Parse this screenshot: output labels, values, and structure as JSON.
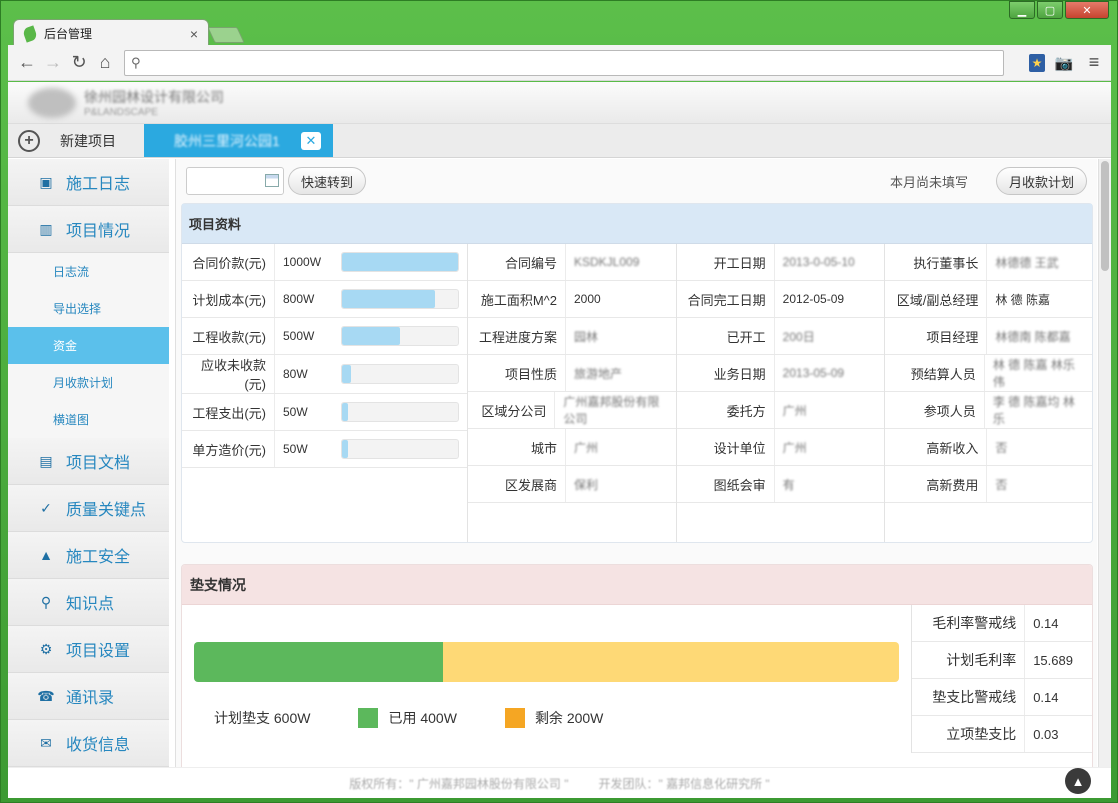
{
  "browser": {
    "tab_title": "后台管理",
    "tab_close": "×",
    "address": "",
    "controls": {
      "min": "▁",
      "max": "▢",
      "close": "✕"
    }
  },
  "header": {
    "company_cn": "徐州园林设计有限公司",
    "company_en": "P&LANDSCAPE"
  },
  "projectbar": {
    "new_project_label": "新建项目",
    "plus": "+",
    "open_tab": "胶州三里河公园1",
    "open_tab_close": "✕"
  },
  "sidebar": {
    "items": [
      {
        "label": "施工日志",
        "icon": "log-icon",
        "glyph": "▣"
      },
      {
        "label": "项目情况",
        "icon": "bar-chart-icon",
        "glyph": "▥"
      },
      {
        "label": "项目文档",
        "icon": "document-icon",
        "glyph": "▤"
      },
      {
        "label": "质量关键点",
        "icon": "quality-check-icon",
        "glyph": "✓"
      },
      {
        "label": "施工安全",
        "icon": "warning-icon",
        "glyph": "▲"
      },
      {
        "label": "知识点",
        "icon": "knowledge-search-icon",
        "glyph": "⚲"
      },
      {
        "label": "项目设置",
        "icon": "gear-icon",
        "glyph": "⚙"
      },
      {
        "label": "通讯录",
        "icon": "contacts-icon",
        "glyph": "☎"
      },
      {
        "label": "收货信息",
        "icon": "mail-icon",
        "glyph": "✉"
      }
    ],
    "subitems": [
      "日志流",
      "导出选择",
      "资金",
      "月收款计划",
      "横道图"
    ]
  },
  "toolbar": {
    "date_value": "",
    "goto_label": "快速转到",
    "month_status": "本月尚未填写",
    "monthly_plan_label": "月收款计划"
  },
  "project_info": {
    "title": "项目资料",
    "money": [
      {
        "label": "合同价款(元)",
        "value": "1000W",
        "fill": 1.0
      },
      {
        "label": "计划成本(元)",
        "value": "800W",
        "fill": 0.8
      },
      {
        "label": "工程收款(元)",
        "value": "500W",
        "fill": 0.5
      },
      {
        "label": "应收未收款(元)",
        "value": "80W",
        "fill": 0.08
      },
      {
        "label": "工程支出(元)",
        "value": "50W",
        "fill": 0.05
      },
      {
        "label": "单方造价(元)",
        "value": "50W",
        "fill": 0.05
      }
    ],
    "col2": [
      {
        "label": "合同编号",
        "value": "KSDKJL009"
      },
      {
        "label": "施工面积M^2",
        "value": "2000"
      },
      {
        "label": "工程进度方案",
        "value": "园林"
      },
      {
        "label": "项目性质",
        "value": "旅游地产"
      },
      {
        "label": "区域分公司",
        "value": "广州嘉邦股份有限公司"
      },
      {
        "label": "城市",
        "value": "广州"
      },
      {
        "label": "区发展商",
        "value": "保利"
      }
    ],
    "col3": [
      {
        "label": "开工日期",
        "value": "2013-0-05-10"
      },
      {
        "label": "合同完工日期",
        "value": "2012-05-09"
      },
      {
        "label": "已开工",
        "value": "200日"
      },
      {
        "label": "业务日期",
        "value": "2013-05-09"
      },
      {
        "label": "委托方",
        "value": "广州"
      },
      {
        "label": "设计单位",
        "value": "广州"
      },
      {
        "label": "图纸会审",
        "value": "有"
      }
    ],
    "col4": [
      {
        "label": "执行董事长",
        "value": "林德德 王武"
      },
      {
        "label": "区域/副总经理",
        "value": "林 德 陈嘉"
      },
      {
        "label": "项目经理",
        "value": "林德南 陈都嘉"
      },
      {
        "label": "预结算人员",
        "value": "林 德 陈嘉 林乐伟"
      },
      {
        "label": "参项人员",
        "value": "李 德 陈嘉均 林乐"
      },
      {
        "label": "高新收入",
        "value": "否"
      },
      {
        "label": "高新费用",
        "value": "否"
      }
    ]
  },
  "advance": {
    "title": "垫支情况",
    "plan_label": "计划垫支 600W",
    "used_label": "已用 400W",
    "remaining_label": "剩余 200W",
    "used_color": "#5cb85c",
    "remaining_color": "#f5a623",
    "used_fraction": 0.3532,
    "metrics": [
      {
        "label": "毛利率警戒线",
        "value": "0.14"
      },
      {
        "label": "计划毛利率",
        "value": "15.689"
      },
      {
        "label": "垫支比警戒线",
        "value": "0.14"
      },
      {
        "label": "立项垫支比",
        "value": "0.03"
      }
    ]
  },
  "footer": {
    "copyright": "版权所有：\" 广州嘉邦园林股份有限公司 \"",
    "developer": "开发团队：\" 嘉邦信息化研究所 \"",
    "totop": "▲"
  }
}
